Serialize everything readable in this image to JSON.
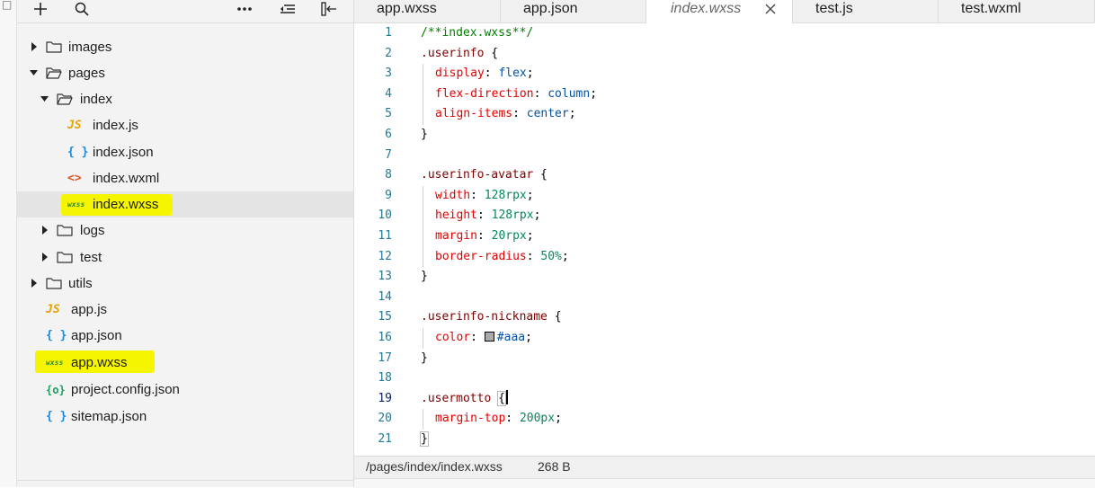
{
  "left_strip": {
    "glyph": "□"
  },
  "explorer": {
    "toolbar": {
      "add_icon": "plus-icon",
      "search_icon": "search-icon",
      "more_icon": "more-icon",
      "collapse_icon": "collapse-all-icon",
      "layout_icon": "split-layout-icon"
    },
    "tree": [
      {
        "label": "images",
        "type": "folder",
        "expanded": false,
        "depth": 0,
        "icon": "folder-icon"
      },
      {
        "label": "pages",
        "type": "folder",
        "expanded": true,
        "depth": 0,
        "icon": "folder-open-icon"
      },
      {
        "label": "index",
        "type": "folder",
        "expanded": true,
        "depth": 1,
        "icon": "folder-open-icon"
      },
      {
        "label": "index.js",
        "type": "js",
        "depth": 2,
        "badge": "JS",
        "icon": "js-file-icon"
      },
      {
        "label": "index.json",
        "type": "json",
        "depth": 2,
        "badge": "{ }",
        "icon": "json-file-icon"
      },
      {
        "label": "index.wxml",
        "type": "wxml",
        "depth": 2,
        "badge": "<>",
        "icon": "wxml-file-icon"
      },
      {
        "label": "index.wxss",
        "type": "wxss",
        "depth": 2,
        "badge": "wxss",
        "icon": "wxss-file-icon",
        "selected": true,
        "highlighted": true
      },
      {
        "label": "logs",
        "type": "folder",
        "expanded": false,
        "depth": 1,
        "icon": "folder-icon"
      },
      {
        "label": "test",
        "type": "folder",
        "expanded": false,
        "depth": 1,
        "icon": "folder-icon"
      },
      {
        "label": "utils",
        "type": "folder",
        "expanded": false,
        "depth": 0,
        "icon": "folder-icon"
      },
      {
        "label": "app.js",
        "type": "js",
        "depth": 0,
        "badge": "JS",
        "icon": "js-file-icon"
      },
      {
        "label": "app.json",
        "type": "json",
        "depth": 0,
        "badge": "{ }",
        "icon": "json-file-icon"
      },
      {
        "label": "app.wxss",
        "type": "wxss",
        "depth": 0,
        "badge": "wxss",
        "icon": "wxss-file-icon",
        "highlighted": true
      },
      {
        "label": "project.config.json",
        "type": "config",
        "depth": 0,
        "badge": "{o}",
        "icon": "config-file-icon"
      },
      {
        "label": "sitemap.json",
        "type": "json",
        "depth": 0,
        "badge": "{ }",
        "icon": "json-file-icon"
      }
    ]
  },
  "tabs": [
    {
      "label": "app.wxss",
      "active": false
    },
    {
      "label": "app.json",
      "active": false
    },
    {
      "label": "index.wxss",
      "active": true,
      "closable": true
    },
    {
      "label": "test.js",
      "active": false
    },
    {
      "label": "test.wxml",
      "active": false
    }
  ],
  "editor": {
    "current_line": 19,
    "lines": [
      {
        "n": "1",
        "tokens": [
          {
            "t": "/**index.wxss**/",
            "c": "com"
          }
        ]
      },
      {
        "n": "2",
        "tokens": [
          {
            "t": ".userinfo",
            "c": "sel"
          },
          {
            "t": " {",
            "c": "pun"
          }
        ]
      },
      {
        "n": "3",
        "indent": true,
        "tokens": [
          {
            "t": "display",
            "c": "prop"
          },
          {
            "t": ": ",
            "c": "pun"
          },
          {
            "t": "flex",
            "c": "val"
          },
          {
            "t": ";",
            "c": "pun"
          }
        ]
      },
      {
        "n": "4",
        "indent": true,
        "tokens": [
          {
            "t": "flex-direction",
            "c": "prop"
          },
          {
            "t": ": ",
            "c": "pun"
          },
          {
            "t": "column",
            "c": "val"
          },
          {
            "t": ";",
            "c": "pun"
          }
        ]
      },
      {
        "n": "5",
        "indent": true,
        "tokens": [
          {
            "t": "align-items",
            "c": "prop"
          },
          {
            "t": ": ",
            "c": "pun"
          },
          {
            "t": "center",
            "c": "val"
          },
          {
            "t": ";",
            "c": "pun"
          }
        ]
      },
      {
        "n": "6",
        "tokens": [
          {
            "t": "}",
            "c": "pun"
          }
        ]
      },
      {
        "n": "7",
        "tokens": []
      },
      {
        "n": "8",
        "tokens": [
          {
            "t": ".userinfo-avatar",
            "c": "sel"
          },
          {
            "t": " {",
            "c": "pun"
          }
        ]
      },
      {
        "n": "9",
        "indent": true,
        "tokens": [
          {
            "t": "width",
            "c": "prop"
          },
          {
            "t": ": ",
            "c": "pun"
          },
          {
            "t": "128",
            "c": "num"
          },
          {
            "t": "rpx",
            "c": "num"
          },
          {
            "t": ";",
            "c": "pun"
          }
        ]
      },
      {
        "n": "10",
        "indent": true,
        "tokens": [
          {
            "t": "height",
            "c": "prop"
          },
          {
            "t": ": ",
            "c": "pun"
          },
          {
            "t": "128rpx",
            "c": "num"
          },
          {
            "t": ";",
            "c": "pun"
          }
        ]
      },
      {
        "n": "11",
        "indent": true,
        "tokens": [
          {
            "t": "margin",
            "c": "prop"
          },
          {
            "t": ": ",
            "c": "pun"
          },
          {
            "t": "20rpx",
            "c": "num"
          },
          {
            "t": ";",
            "c": "pun"
          }
        ]
      },
      {
        "n": "12",
        "indent": true,
        "tokens": [
          {
            "t": "border-radius",
            "c": "prop"
          },
          {
            "t": ": ",
            "c": "pun"
          },
          {
            "t": "50%",
            "c": "num"
          },
          {
            "t": ";",
            "c": "pun"
          }
        ]
      },
      {
        "n": "13",
        "tokens": [
          {
            "t": "}",
            "c": "pun"
          }
        ]
      },
      {
        "n": "14",
        "tokens": []
      },
      {
        "n": "15",
        "tokens": [
          {
            "t": ".userinfo-nickname",
            "c": "sel"
          },
          {
            "t": " {",
            "c": "pun"
          }
        ]
      },
      {
        "n": "16",
        "indent": true,
        "tokens": [
          {
            "t": "color",
            "c": "prop"
          },
          {
            "t": ": ",
            "c": "pun"
          },
          {
            "t": "",
            "c": "swatch"
          },
          {
            "t": "#aaa",
            "c": "val"
          },
          {
            "t": ";",
            "c": "pun"
          }
        ]
      },
      {
        "n": "17",
        "tokens": [
          {
            "t": "}",
            "c": "pun"
          }
        ]
      },
      {
        "n": "18",
        "tokens": []
      },
      {
        "n": "19",
        "tokens": [
          {
            "t": ".usermotto",
            "c": "sel"
          },
          {
            "t": " ",
            "c": "pun"
          },
          {
            "t": "{",
            "c": "bracket"
          },
          {
            "t": "",
            "c": "caret"
          }
        ]
      },
      {
        "n": "20",
        "indent": true,
        "tokens": [
          {
            "t": "margin-top",
            "c": "prop"
          },
          {
            "t": ": ",
            "c": "pun"
          },
          {
            "t": "200px",
            "c": "num"
          },
          {
            "t": ";",
            "c": "pun"
          }
        ]
      },
      {
        "n": "21",
        "tokens": [
          {
            "t": "}",
            "c": "bracket"
          }
        ]
      }
    ]
  },
  "status": {
    "path": "/pages/index/index.wxss",
    "size": "268 B"
  },
  "colors": {
    "highlight": "#f5f500",
    "selected_row": "#e4e4e4",
    "line_number": "#237893",
    "selector": "#800000",
    "property": "#e50000",
    "value": "#0451a5",
    "comment": "#008000"
  }
}
